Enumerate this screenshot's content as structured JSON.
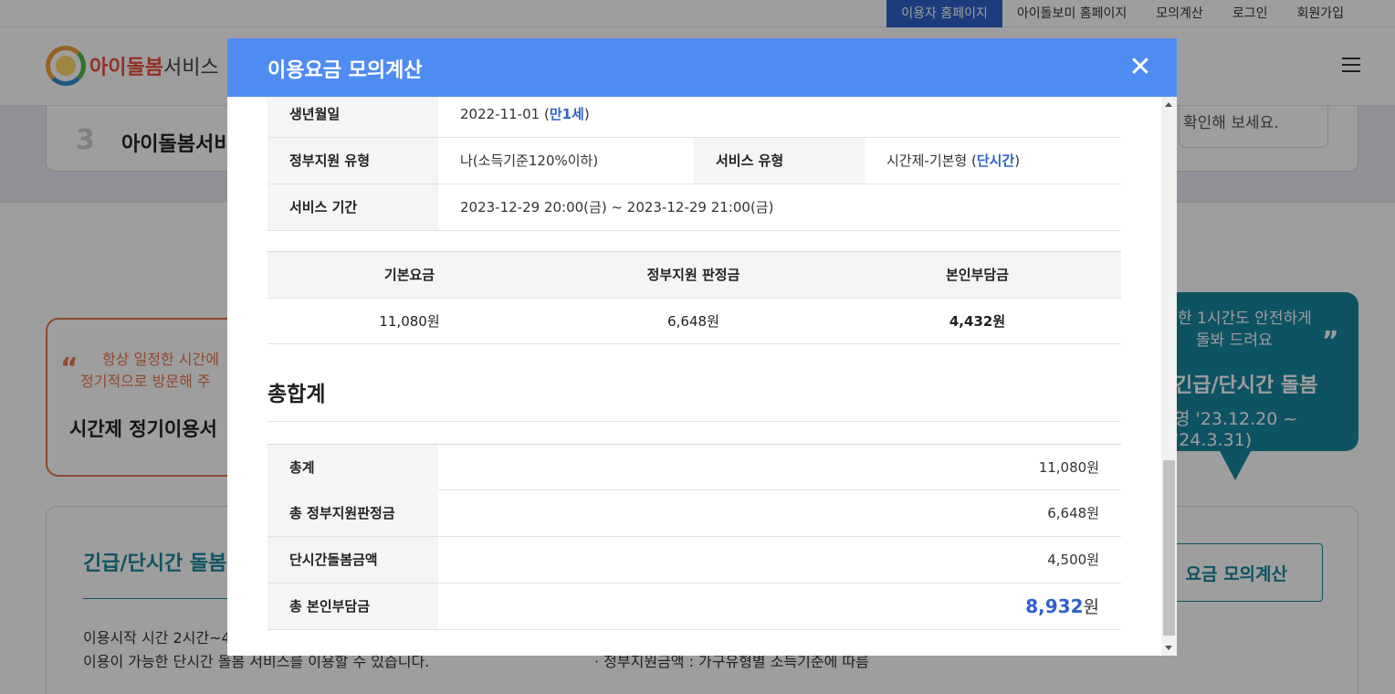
{
  "topbar": {
    "links": [
      "이용자 홈페이지",
      "아이돌보미 홈페이지",
      "모의계산",
      "로그인",
      "회원가입"
    ]
  },
  "header": {
    "logo_bold": "아이돌봄",
    "logo_rest": "서비스"
  },
  "background": {
    "step_number": "3",
    "step_title": "아이돌봄서비",
    "step_hint": "확인해 보세요.",
    "left_card": {
      "quote": "“",
      "line1": "항상 일정한 시간에",
      "line2": "정기적으로 방문해 주",
      "line3": "시간제 정기이용서"
    },
    "right_card": {
      "line1": "한 1시간도 안전하게",
      "line2": "돌봐 드려요",
      "quote": "”",
      "line3": "긴급/단시간 돌봄",
      "line4": "영 '23.12.20 ~ '24.3.31)"
    },
    "bottom": {
      "title": "긴급/단시간 돌봄",
      "text1": "이용시작 시간 2시간~4",
      "text2": "이용이 가능한 단시간 돌봄 서비스를 이용할 수 있습니다.",
      "text3": "· 정부지원금액 : 가구유형별 소득기준에 따름",
      "calc_button": "요금 모의계산"
    }
  },
  "modal": {
    "title": "이용요금 모의계산",
    "close_label": "✕",
    "info": {
      "birth_label": "생년월일",
      "birth_value": "2022-11-01",
      "birth_open": " (",
      "birth_age": "만1세",
      "birth_close": ")",
      "support_label": "정부지원 유형",
      "support_value": "나(소득기준120%이하)",
      "service_type_label": "서비스 유형",
      "service_type_value": "시간제-기본형",
      "service_type_open": " (",
      "service_type_tag": "단시간",
      "service_type_close": ")",
      "period_label": "서비스 기간",
      "period_value": "2023-12-29 20:00(금) ~ 2023-12-29 21:00(금)"
    },
    "fee_table": {
      "headers": [
        "기본요금",
        "정부지원 판정금",
        "본인부담금"
      ],
      "values": [
        "11,080원",
        "6,648원",
        "4,432원"
      ]
    },
    "summary": {
      "title": "총합계",
      "rows": [
        {
          "label": "총계",
          "value": "11,080원"
        },
        {
          "label": "총 정부지원판정금",
          "value": "6,648원"
        },
        {
          "label": "단시간돌봄금액",
          "value": "4,500원"
        }
      ],
      "total_label": "총 본인부담금",
      "total_value": "8,932",
      "total_unit": "원"
    }
  },
  "colors": {
    "modal_header": "#4f8cf2",
    "highlight": "#2e62c9",
    "teal": "#17879f",
    "orange": "#e8744a"
  }
}
